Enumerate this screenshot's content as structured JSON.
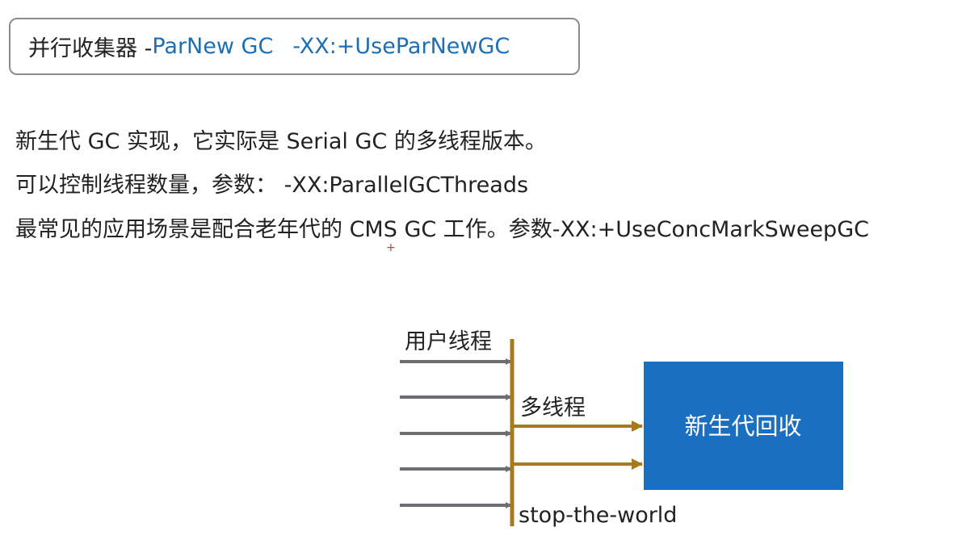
{
  "title": {
    "prefix": "并行收集器 - ",
    "name": "ParNew GC",
    "flag": "-XX:+UseParNewGC"
  },
  "description": [
    "新生代 GC 实现，它实际是 Serial GC 的多线程版本。",
    "可以控制线程数量，参数： -XX:ParallelGCThreads",
    "最常见的应用场景是配合老年代的 CMS GC 工作。参数-XX:+UseConcMarkSweepGC"
  ],
  "cursor_glyph": "+",
  "diagram": {
    "user_threads_label": "用户线程",
    "multi_thread_label": "多线程",
    "stop_label": "stop-the-world",
    "collect_box_label": "新生代回收",
    "user_thread_count": 5,
    "gc_thread_count": 2,
    "colors": {
      "user_arrow": "#6e6e72",
      "gc_line": "#a57b1e",
      "box_fill": "#1b6fc0",
      "box_text": "#ffffff",
      "accent": "#1c6fb5"
    }
  }
}
